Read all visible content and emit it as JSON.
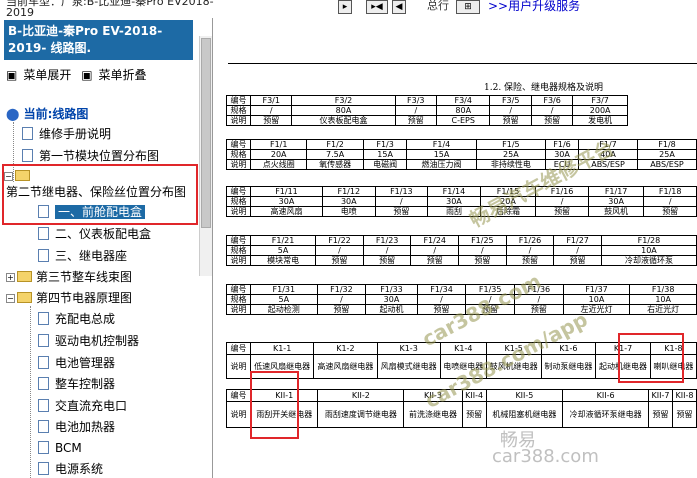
{
  "topbar": {
    "text": "当前车型：广泉:B-比亚迪-秦Pro EV2018-\n2019",
    "btn1": "▸",
    "btn2": "▸◀",
    "btn3": "◀",
    "tail_text": "总行",
    "link": ">>用户升级服务"
  },
  "left": {
    "banner": "B-比亚迪-秦Pro EV-2018-2019- 线路图.",
    "expand": "菜单展开",
    "collapse": "菜单折叠",
    "current": "当前:线路图",
    "items": [
      "维修手册说明",
      "第一节模块位置分布图",
      "第二节继电器、保险丝位置分布图",
      "一、前舱配电盒",
      "二、仪表板配电盒",
      "三、继电器座",
      "第三节整车线束图",
      "第四节电器原理图",
      "充配电总成",
      "驱动电机控制器",
      "电池管理器",
      "整车控制器",
      "交直流充电口",
      "电池加热器",
      "BCM",
      "电源系统"
    ]
  },
  "doc": {
    "title": "1.2. 保险、继电器规格及说明",
    "row_labels": [
      "编号",
      "规格",
      "说明"
    ],
    "f3": {
      "ids": [
        "F3/1",
        "F3/2",
        "F3/3",
        "F3/4",
        "F3/5",
        "F3/6",
        "F3/7"
      ],
      "specs": [
        "/",
        "80A",
        "/",
        "80A",
        "/",
        "/",
        "200A"
      ],
      "desc": [
        "预留",
        "仪表板配电盒",
        "预留",
        "C-EPS",
        "预留",
        "预留",
        "发电机"
      ]
    },
    "f1a": {
      "ids": [
        "F1/1",
        "F1/2",
        "F1/3",
        "F1/4",
        "F1/5",
        "F1/6",
        "F1/7",
        "F1/8"
      ],
      "specs": [
        "20A",
        "7.5A",
        "15A",
        "15A",
        "25A",
        "30A",
        "40A",
        "25A"
      ],
      "desc": [
        "点火线圈",
        "氧传感器",
        "电磁阀",
        "燃油压力阀",
        "非持续性电",
        "ECU",
        "ABS/ESP",
        "ABS/ESP"
      ]
    },
    "f1b": {
      "ids": [
        "F1/11",
        "F1/12",
        "F1/13",
        "F1/14",
        "F1/15",
        "F1/16",
        "F1/17",
        "F1/18"
      ],
      "specs": [
        "30A",
        "30A",
        "/",
        "30A",
        "20A",
        "/",
        "30A",
        "/"
      ],
      "desc": [
        "高速风扇",
        "电喷",
        "预留",
        "雨刮",
        "后除霜",
        "预留",
        "鼓风机",
        "预留"
      ]
    },
    "f1c": {
      "ids": [
        "F1/21",
        "F1/22",
        "F1/23",
        "F1/24",
        "F1/25",
        "F1/26",
        "F1/27",
        "F1/28"
      ],
      "specs": [
        "5A",
        "/",
        "/",
        "/",
        "/",
        "/",
        "/",
        "10A"
      ],
      "desc": [
        "模块常电",
        "预留",
        "预留",
        "预留",
        "预留",
        "预留",
        "预留",
        "冷却液循环泵"
      ]
    },
    "f1d": {
      "ids": [
        "F1/31",
        "F1/32",
        "F1/33",
        "F1/34",
        "F1/35",
        "F1/36",
        "F1/37",
        "F1/38"
      ],
      "specs": [
        "5A",
        "/",
        "30A",
        "/",
        "/",
        "/",
        "10A",
        "10A"
      ],
      "desc": [
        "起动检测",
        "预留",
        "起动机",
        "预留",
        "预留",
        "预留",
        "左近光灯",
        "右近光灯"
      ]
    },
    "k1": {
      "ids": [
        "K1-1",
        "K1-2",
        "K1-3",
        "K1-4",
        "K1-5",
        "K1-6",
        "K1-7",
        "K1-8"
      ],
      "desc": [
        "低速风扇继电器",
        "高速风扇继电器",
        "风扇模式继电器",
        "电喷继电器",
        "鼓风机继电器",
        "制动泵继电器",
        "起动机继电器",
        "喇叭继电器"
      ]
    },
    "kii": {
      "ids": [
        "KII-1",
        "KII-2",
        "KII-3",
        "KII-4",
        "KII-5",
        "KII-6",
        "KII-7",
        "KII-8"
      ],
      "desc": [
        "雨刮开关继电器",
        "雨刮速度调节继电器",
        "前洗涤继电器",
        "预留",
        "机械阻塞机继电器",
        "冷却液循环泵继电器",
        "预留",
        "预留"
      ]
    },
    "watermarks": [
      "畅易汽车维修平台",
      "car388.com",
      "car388.com/app",
      "畅易",
      "car388.com"
    ]
  }
}
